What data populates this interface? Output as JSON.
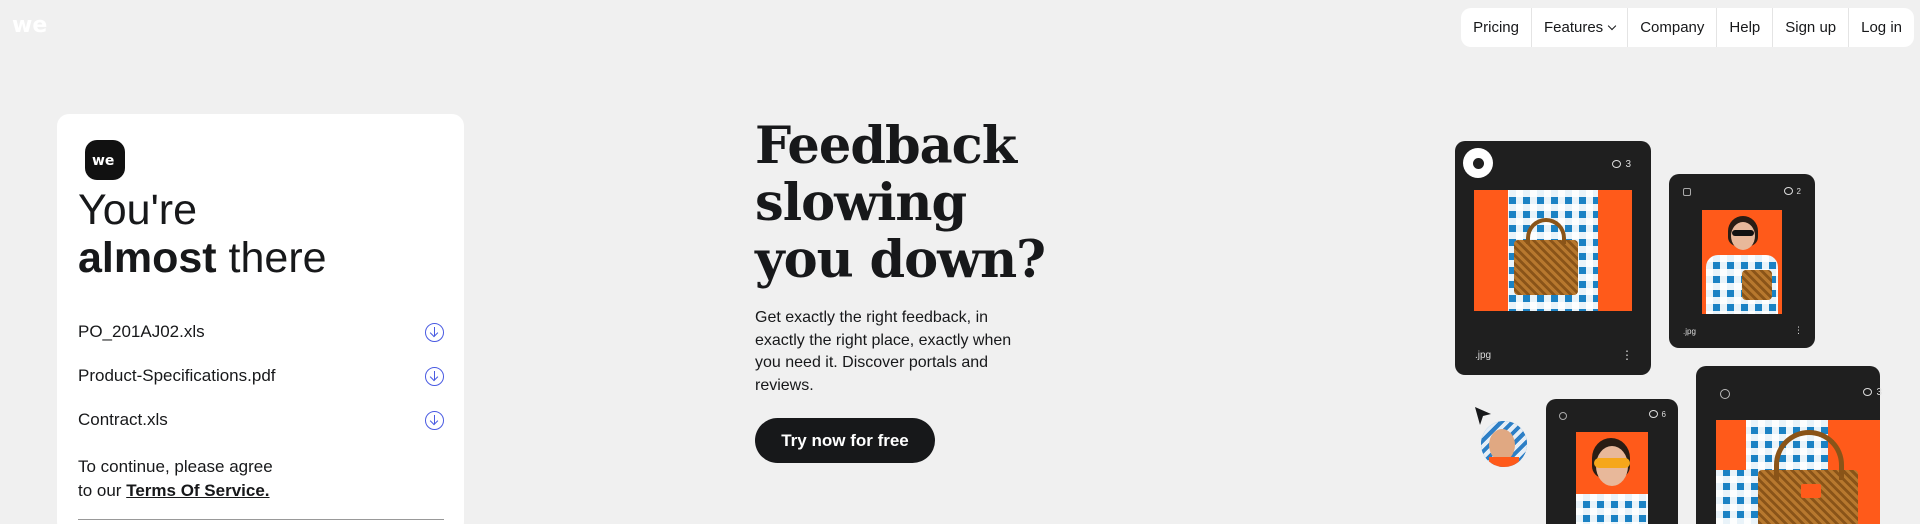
{
  "nav": {
    "items": [
      {
        "label": "Pricing"
      },
      {
        "label": "Features"
      },
      {
        "label": "Company"
      },
      {
        "label": "Help"
      },
      {
        "label": "Sign up"
      },
      {
        "label": "Log in"
      }
    ]
  },
  "card": {
    "title_line1": "You're",
    "title_bold": "almost",
    "title_rest": " there",
    "files": [
      {
        "name": "PO_201AJ02.xls"
      },
      {
        "name": "Product-Specifications.pdf"
      },
      {
        "name": "Contract.xls"
      }
    ],
    "agree_text_1": "To continue, please agree",
    "agree_text_2": "to our ",
    "terms_link": "Terms Of Service."
  },
  "hero": {
    "headline_1": "Feedback",
    "headline_2": "slowing",
    "headline_3": "you down?",
    "subtext": "Get exactly the right feedback, in exactly the right place, exactly when you need it. Discover portals and reviews.",
    "cta_label": "Try now for free"
  },
  "illustration": {
    "tile1": {
      "comments": "3",
      "ext": ".jpg"
    },
    "tile2": {
      "comments": "2",
      "ext": ".jpg"
    },
    "tile3": {
      "comments": "6"
    },
    "tile4": {
      "comments": "3"
    }
  },
  "colors": {
    "background": "#f0f0f0",
    "accent_blue": "#4a5be2",
    "dark": "#17181a",
    "orange": "#ff5a1a"
  }
}
